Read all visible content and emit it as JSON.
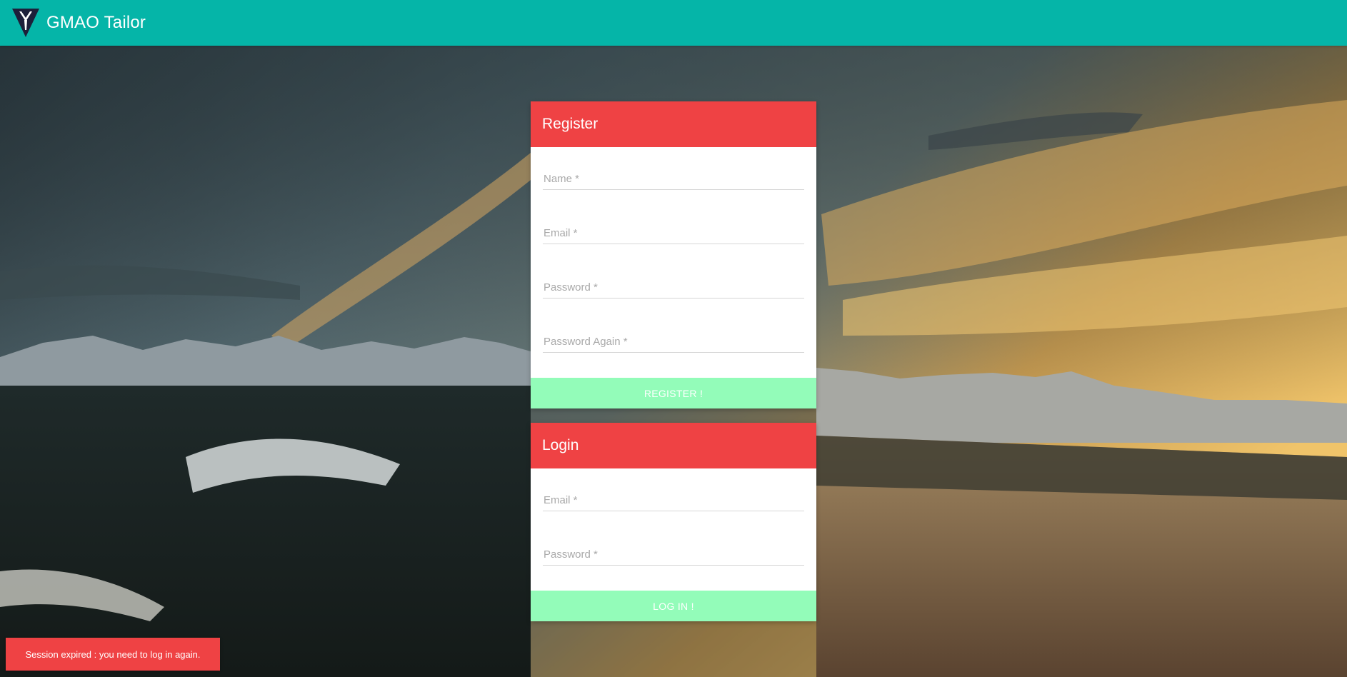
{
  "header": {
    "app_title": "GMAO Tailor",
    "logo_icon": "tailor-suit-logo-icon",
    "bar_color": "#05b5a8"
  },
  "register": {
    "title": "Register",
    "fields": [
      {
        "label": "Name *",
        "value": ""
      },
      {
        "label": "Email *",
        "value": ""
      },
      {
        "label": "Password *",
        "value": ""
      },
      {
        "label": "Password Again *",
        "value": ""
      }
    ],
    "submit_label": "REGISTER !"
  },
  "login": {
    "title": "Login",
    "fields": [
      {
        "label": "Email *",
        "value": ""
      },
      {
        "label": "Password *",
        "value": ""
      }
    ],
    "submit_label": "LOG IN !"
  },
  "toast": {
    "message": "Session expired : you need to log in again."
  },
  "colors": {
    "card_header": "#ef4244",
    "submit_button": "#93fcb9",
    "toast": "#ef4244"
  }
}
